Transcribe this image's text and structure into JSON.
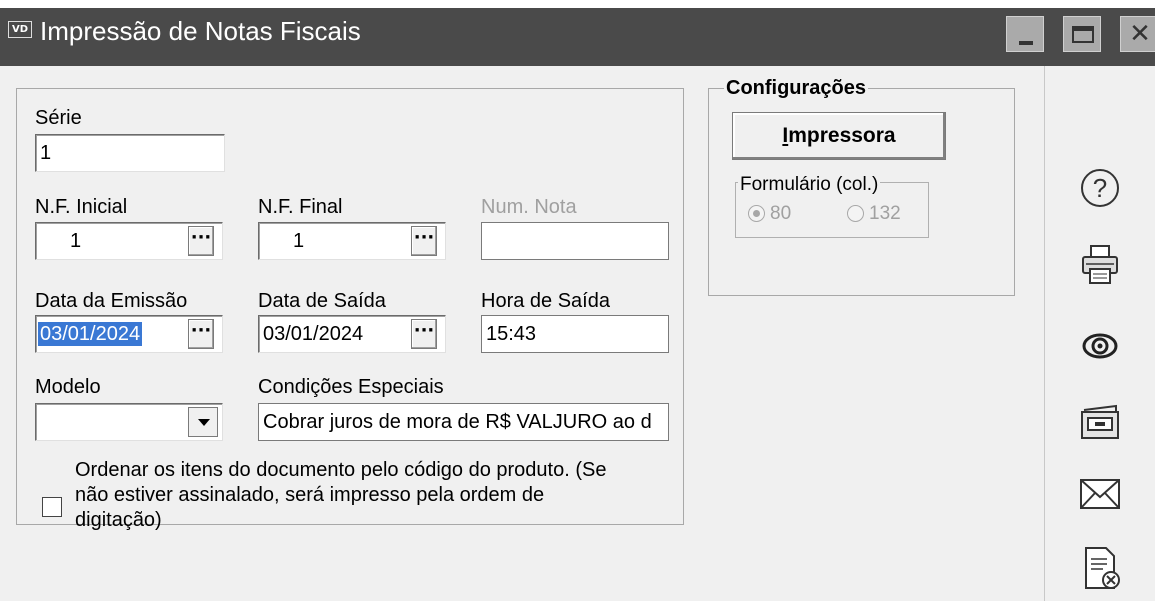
{
  "window": {
    "app_badge": "VD",
    "title": "Impressão de Notas Fiscais"
  },
  "form": {
    "serie_label": "Série",
    "serie_value": "1",
    "nf_inicial_label": "N.F. Inicial",
    "nf_inicial_value": "1",
    "nf_final_label": "N.F. Final",
    "nf_final_value": "1",
    "num_nota_label": "Num. Nota",
    "num_nota_value": "",
    "data_emissao_label": "Data da Emissão",
    "data_emissao_value": "03/01/2024",
    "data_saida_label": "Data de Saída",
    "data_saida_value": "03/01/2024",
    "hora_saida_label": "Hora de Saída",
    "hora_saida_value": "15:43",
    "modelo_label": "Modelo",
    "modelo_value": "",
    "condicoes_label": "Condições Especiais",
    "condicoes_value": "Cobrar juros de mora de R$ VALJURO ao d",
    "ellipsis": "···",
    "ordenar_checked": false,
    "ordenar_label": "Ordenar os itens do documento pelo código do produto. (Se não estiver assinalado, será impresso pela ordem de digitação)"
  },
  "config": {
    "legend": "Configurações",
    "printer_button_first": "I",
    "printer_button_rest": "mpressora",
    "formulario_legend": "Formulário (col.)",
    "options": [
      {
        "label": "80",
        "checked": true
      },
      {
        "label": "132",
        "checked": false
      }
    ]
  },
  "sidebar": {
    "icons": [
      "help-icon",
      "printer-icon",
      "eye-preview-icon",
      "archive-tray-icon",
      "envelope-email-icon",
      "document-cancel-icon"
    ]
  }
}
